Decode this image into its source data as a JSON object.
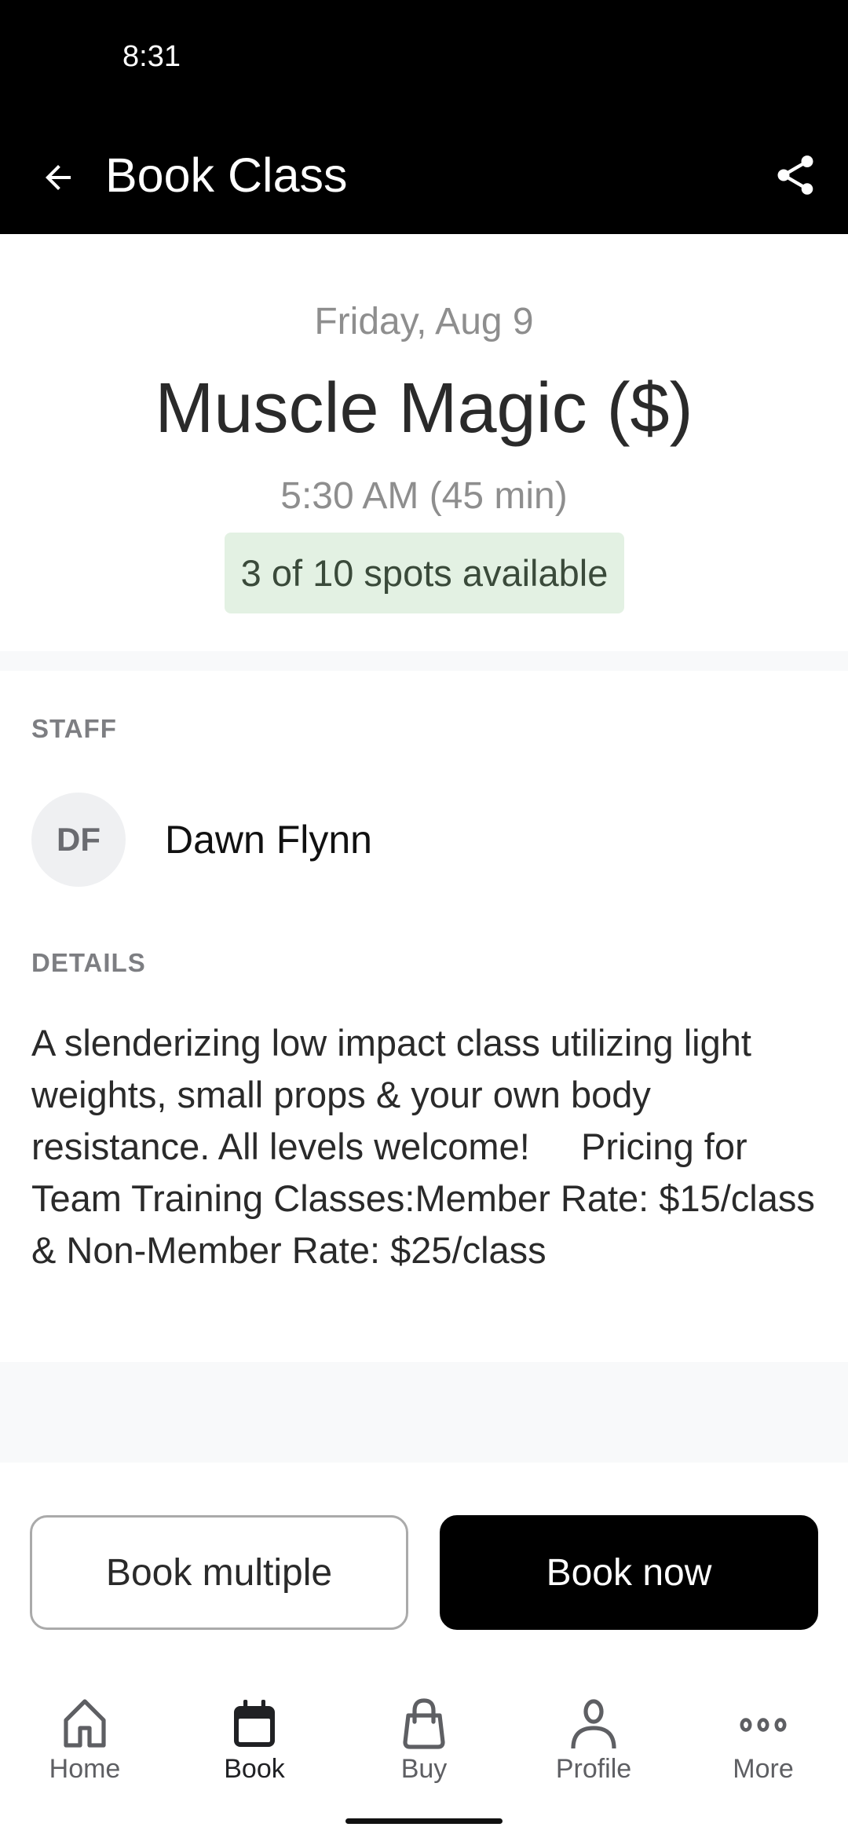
{
  "status_bar": {
    "time": "8:31"
  },
  "header": {
    "title": "Book Class",
    "back_icon": "arrow-left-icon",
    "share_icon": "share-icon"
  },
  "class_info": {
    "date": "Friday, Aug 9",
    "title": "Muscle Magic ($)",
    "time": "5:30 AM (45 min)",
    "spots_text": "3 of 10 spots available",
    "spots_available": 3,
    "spots_total": 10,
    "badge_color": "#e3f1e3"
  },
  "staff": {
    "label": "STAFF",
    "members": [
      {
        "initials": "DF",
        "name": "Dawn Flynn"
      }
    ]
  },
  "details": {
    "label": "DETAILS",
    "description": "A slenderizing low impact class utilizing light weights, small props & your own body resistance. All levels welcome!     Pricing for Team Training Classes:Member Rate: $15/class & Non-Member Rate: $25/class"
  },
  "actions": {
    "book_multiple": "Book multiple",
    "book_now": "Book now"
  },
  "bottom_nav": {
    "items": [
      {
        "label": "Home",
        "icon": "home-icon",
        "active": false
      },
      {
        "label": "Book",
        "icon": "calendar-icon",
        "active": true
      },
      {
        "label": "Buy",
        "icon": "shopping-bag-icon",
        "active": false
      },
      {
        "label": "Profile",
        "icon": "person-icon",
        "active": false
      },
      {
        "label": "More",
        "icon": "more-dots-icon",
        "active": false
      }
    ]
  },
  "colors": {
    "header_bg": "#000000",
    "primary_button": "#000000",
    "nav_active": "#202124",
    "nav_inactive": "#5e5f63"
  }
}
